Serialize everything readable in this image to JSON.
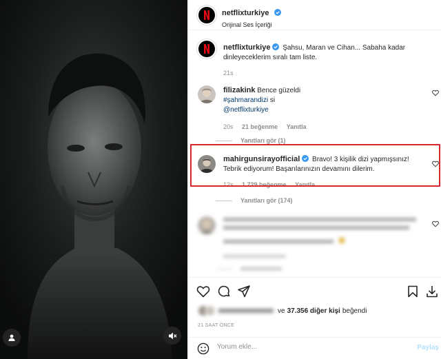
{
  "header": {
    "username": "netflixturkiye",
    "subtitle": "Orijinal Ses İçeriği"
  },
  "caption": {
    "username": "netflixturkiye",
    "text": "Şahsu, Maran ve Cihan... Sabaha kadar dinleyeceklerim sıralı tam liste.",
    "time": "21s"
  },
  "comments": [
    {
      "username": "filizakink",
      "text": "Bence güzeldi",
      "tag": "#şahmarandizi",
      "text2": "si",
      "mention": "@netflixturkiye",
      "time": "20s",
      "likes": "21 beğenme",
      "reply": "Yanıtla",
      "view_replies": "Yanıtları gör (1)"
    },
    {
      "username": "mahirgunsirayofficial",
      "text": "Bravo! 3 kişilik dizi yapmışsınız! Tebrik ediyorum! Başarılarınızın devamını dilerim.",
      "time": "12s",
      "likes": "1.729 beğenme",
      "reply": "Yanıtla",
      "view_replies": "Yanıtları gör (174)"
    }
  ],
  "likes_line": {
    "count_text": "37.356 diğer kişi",
    "connector": "ve",
    "suffix": "beğendi"
  },
  "post_time": "21 SAAT ÖNCE",
  "add_comment": {
    "placeholder": "Yorum ekle...",
    "share_label": "Paylaş"
  },
  "colors": {
    "highlight": "#d9262b",
    "verified": "#3897f0",
    "netflix_red": "#e50914"
  },
  "icons": {
    "media": [
      "user-tag-icon",
      "mute-icon"
    ],
    "actions": [
      "heart-icon",
      "comment-icon",
      "share-icon",
      "bookmark-icon",
      "download-icon"
    ],
    "comment_actions": [
      "heart-icon"
    ],
    "emoji": "smiley-icon"
  }
}
